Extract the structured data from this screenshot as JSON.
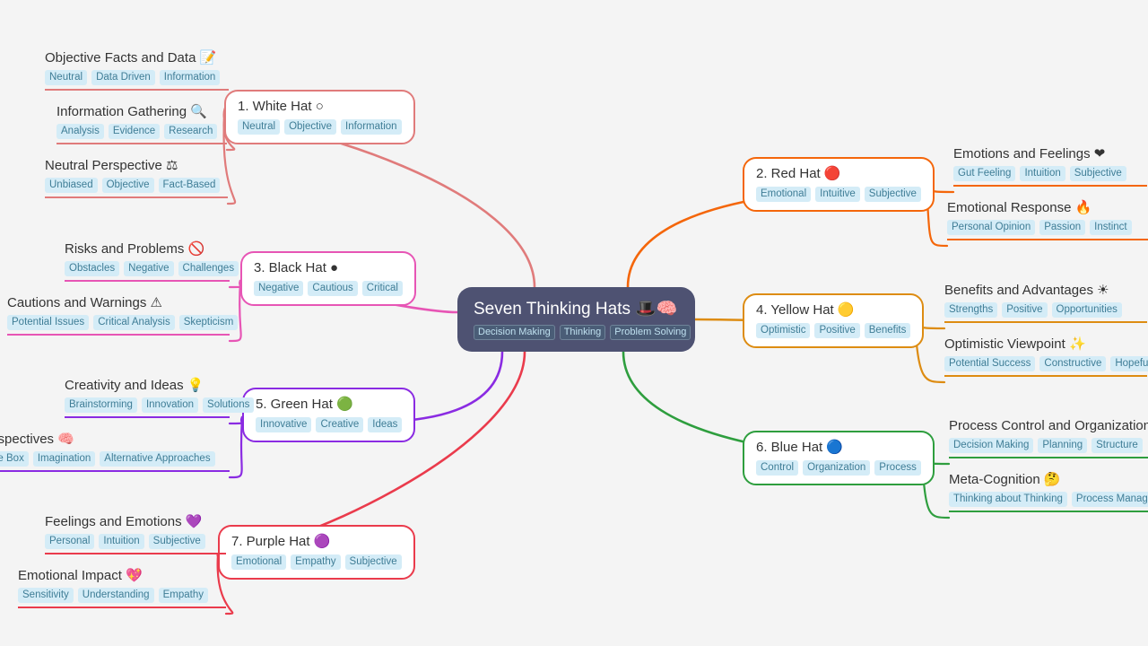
{
  "canvas": {
    "background": "#f4f4f4"
  },
  "center": {
    "title": "Seven Thinking Hats 🎩🧠",
    "color": "#4e5272",
    "tags": [
      "Decision Making",
      "Thinking",
      "Problem Solving"
    ]
  },
  "branches": [
    {
      "id": "white-hat",
      "title": "1. White Hat ○",
      "color": "#e07b7b",
      "side": "left",
      "tags": [
        "Neutral",
        "Objective",
        "Information"
      ],
      "children": [
        {
          "title": "Objective Facts and Data 📝",
          "tags": [
            "Neutral",
            "Data Driven",
            "Information"
          ]
        },
        {
          "title": "Information Gathering 🔍",
          "tags": [
            "Analysis",
            "Evidence",
            "Research"
          ]
        },
        {
          "title": "Neutral Perspective ⚖",
          "tags": [
            "Unbiased",
            "Objective",
            "Fact-Based"
          ]
        }
      ]
    },
    {
      "id": "red-hat",
      "title": "2. Red Hat 🔴",
      "color": "#f4660a",
      "side": "right",
      "tags": [
        "Emotional",
        "Intuitive",
        "Subjective"
      ],
      "children": [
        {
          "title": "Emotions and Feelings ❤",
          "tags": [
            "Gut Feeling",
            "Intuition",
            "Subjective"
          ]
        },
        {
          "title": "Emotional Response 🔥",
          "tags": [
            "Personal Opinion",
            "Passion",
            "Instinct"
          ]
        }
      ]
    },
    {
      "id": "black-hat",
      "title": "3. Black Hat ●",
      "color": "#e755b5",
      "side": "left",
      "tags": [
        "Negative",
        "Cautious",
        "Critical"
      ],
      "children": [
        {
          "title": "Risks and Problems 🚫",
          "tags": [
            "Obstacles",
            "Negative",
            "Challenges"
          ]
        },
        {
          "title": "Cautions and Warnings ⚠",
          "tags": [
            "Potential Issues",
            "Critical Analysis",
            "Skepticism"
          ]
        }
      ]
    },
    {
      "id": "yellow-hat",
      "title": "4. Yellow Hat 🟡",
      "color": "#dd8c12",
      "side": "right",
      "tags": [
        "Optimistic",
        "Positive",
        "Benefits"
      ],
      "children": [
        {
          "title": "Benefits and Advantages ☀",
          "tags": [
            "Strengths",
            "Positive",
            "Opportunities"
          ]
        },
        {
          "title": "Optimistic Viewpoint ✨",
          "tags": [
            "Potential Success",
            "Constructive",
            "Hopeful"
          ]
        }
      ]
    },
    {
      "id": "green-hat",
      "title": "5. Green Hat 🟢",
      "color": "#8a2be2",
      "side": "left",
      "tags": [
        "Innovative",
        "Creative",
        "Ideas"
      ],
      "children": [
        {
          "title": "Creativity and Ideas 💡",
          "tags": [
            "Brainstorming",
            "Innovation",
            "Solutions"
          ]
        },
        {
          "title": "New Perspectives 🧠",
          "tags": [
            "Outside the Box",
            "Imagination",
            "Alternative Approaches"
          ]
        }
      ]
    },
    {
      "id": "blue-hat",
      "title": "6. Blue Hat 🔵",
      "color": "#2e9e3e",
      "side": "right",
      "tags": [
        "Control",
        "Organization",
        "Process"
      ],
      "children": [
        {
          "title": "Process Control and Organization 🧭",
          "tags": [
            "Decision Making",
            "Planning",
            "Structure"
          ]
        },
        {
          "title": "Meta-Cognition 🤔",
          "tags": [
            "Thinking about Thinking",
            "Process Management"
          ]
        }
      ]
    },
    {
      "id": "purple-hat",
      "title": "7. Purple Hat 🟣",
      "color": "#ea3b4c",
      "side": "left",
      "tags": [
        "Emotional",
        "Empathy",
        "Subjective"
      ],
      "children": [
        {
          "title": "Feelings and Emotions 💜",
          "tags": [
            "Personal",
            "Intuition",
            "Subjective"
          ]
        },
        {
          "title": "Emotional Impact 💖",
          "tags": [
            "Sensitivity",
            "Understanding",
            "Empathy"
          ]
        }
      ]
    }
  ]
}
